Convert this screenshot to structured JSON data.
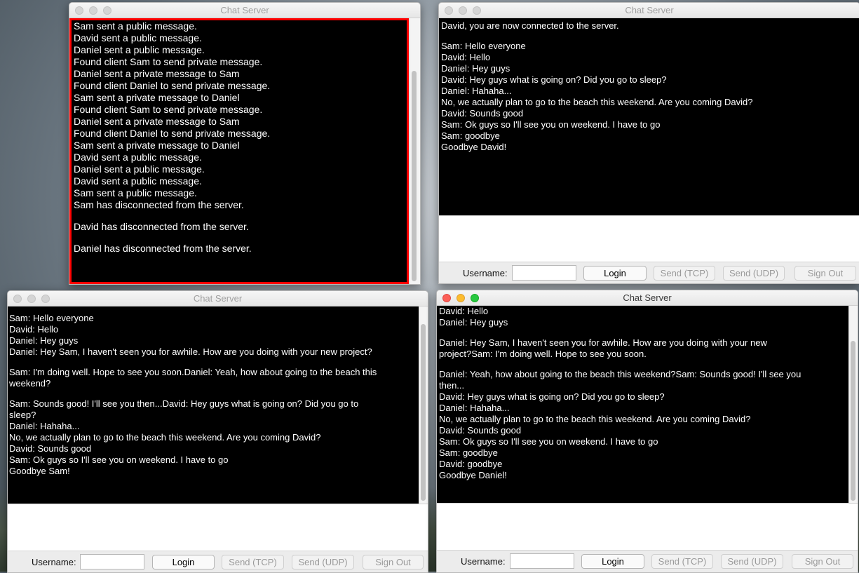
{
  "windows": {
    "server": {
      "title": "Chat Server",
      "log": [
        "Sam sent a public message.",
        "David sent a public message.",
        "Daniel sent a public message.",
        "Found client Sam to send private message.",
        "Daniel sent a private message to Sam",
        "Found client Daniel to send private message.",
        "Sam sent a private message to Daniel",
        "Found client Sam to send private message.",
        "Daniel sent a private message to Sam",
        "Found client Daniel to send private message.",
        "Sam sent a private message to Daniel",
        "David sent a public message.",
        "Daniel sent a public message.",
        "David sent a public message.",
        "Sam sent a public message.",
        "Sam has disconnected from the server.",
        "",
        "David has disconnected from the server.",
        "",
        "Daniel has disconnected from the server."
      ]
    },
    "david": {
      "title": "Chat Server",
      "log": [
        "David, you are now connected to the server.",
        "",
        "Sam: Hello everyone",
        "David: Hello",
        "Daniel: Hey guys",
        "David: Hey guys what is going on? Did you go to sleep?",
        "Daniel: Hahaha...",
        "No, we actually plan to go to the beach this weekend. Are you coming David?",
        "David: Sounds good",
        "Sam: Ok guys so I'll see you on weekend. I have to go",
        "Sam: goodbye",
        "Goodbye David!"
      ]
    },
    "sam": {
      "title": "Chat Server",
      "log": [
        "Sam: Hello everyone",
        "David: Hello",
        "Daniel: Hey guys",
        "Daniel: Hey Sam, I haven't seen you for awhile. How are you doing with your new project?",
        "",
        "Sam: I'm doing well. Hope to see you soon.Daniel: Yeah, how about going to the beach this",
        "weekend?",
        "",
        "Sam: Sounds good! I'll see you then...David: Hey guys what is going on? Did you go to",
        "sleep?",
        "Daniel: Hahaha...",
        "No, we actually plan to go to the beach this weekend. Are you coming David?",
        "David: Sounds good",
        "Sam: Ok guys so I'll see you on weekend. I have to go",
        "Goodbye Sam!"
      ]
    },
    "daniel": {
      "title": "Chat Server",
      "log": [
        "David: Hello",
        "Daniel: Hey guys",
        "",
        "Daniel: Hey Sam, I haven't seen you for awhile. How are you doing with your new",
        "project?Sam: I'm doing well. Hope to see you soon.",
        "",
        "Daniel: Yeah, how about going to the beach this weekend?Sam: Sounds good! I'll see you",
        "then...",
        "David: Hey guys what is going on? Did you go to sleep?",
        "Daniel: Hahaha...",
        "No, we actually plan to go to the beach this weekend. Are you coming David?",
        "David: Sounds good",
        "Sam: Ok guys so I'll see you on weekend. I have to go",
        "Sam: goodbye",
        "David: goodbye",
        "Goodbye Daniel!"
      ]
    }
  },
  "controls": {
    "username_label": "Username:",
    "username_value": "",
    "login_label": "Login",
    "send_tcp_label": "Send (TCP)",
    "send_udp_label": "Send (UDP)",
    "sign_out_label": "Sign Out"
  }
}
